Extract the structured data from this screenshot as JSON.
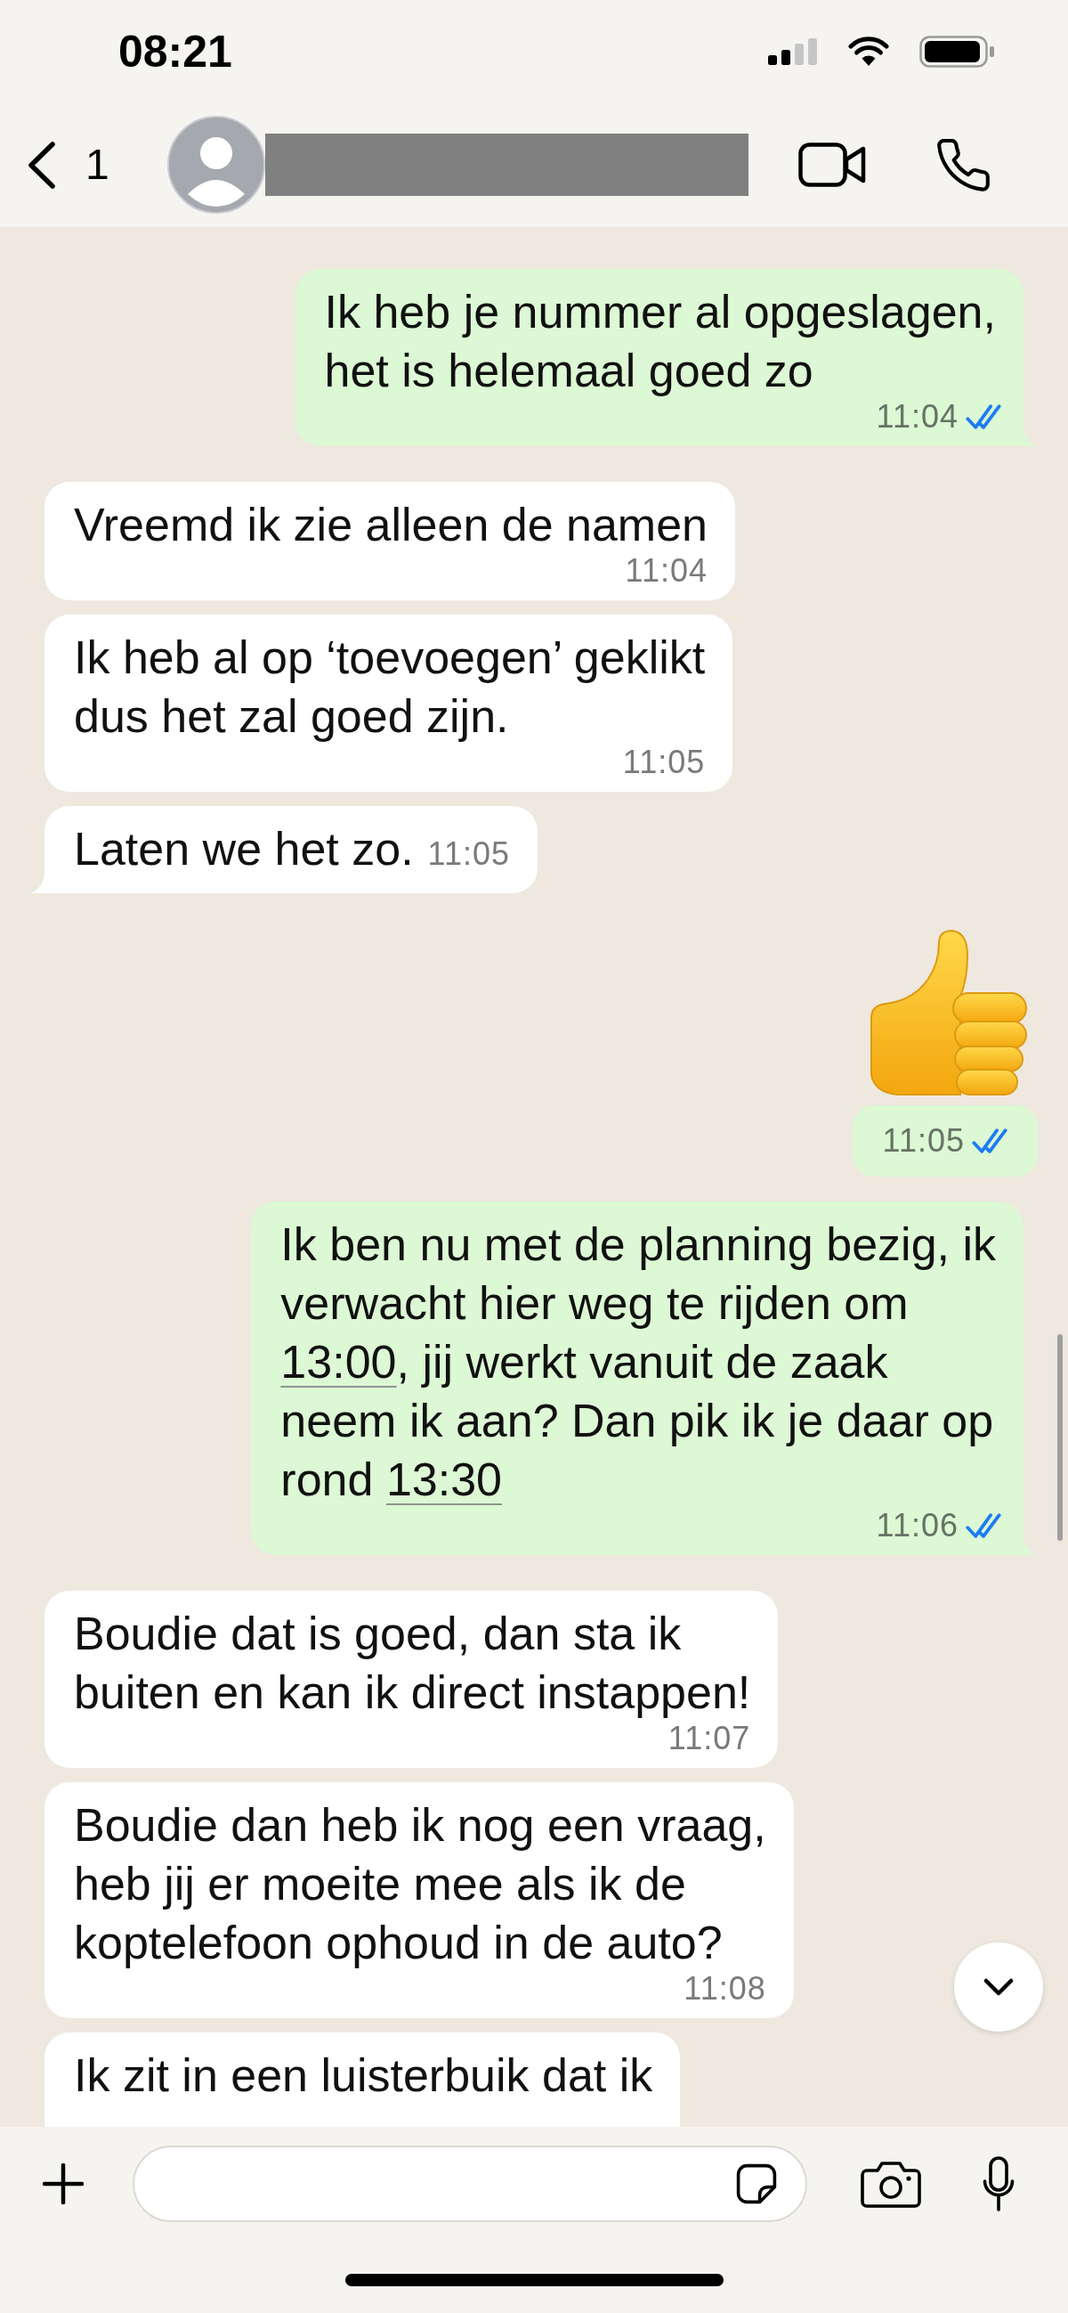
{
  "status_bar": {
    "time": "08:21"
  },
  "header": {
    "back_count": "1"
  },
  "messages": [
    {
      "kind": "text",
      "outgoing": true,
      "text": "Ik heb je nummer al opgeslagen,\nhet is helemaal goed zo",
      "time": "11:04",
      "read": true,
      "tail": true
    },
    {
      "kind": "text",
      "outgoing": false,
      "text": "Vreemd ik zie alleen de namen",
      "time": "11:04",
      "tail": false
    },
    {
      "kind": "text",
      "outgoing": false,
      "text": "Ik heb al op ‘toevoegen’ geklikt\ndus het zal goed zijn.",
      "time": "11:05",
      "tail": false
    },
    {
      "kind": "text",
      "outgoing": false,
      "text": "Laten we het zo.",
      "time": "11:05",
      "tail": true
    },
    {
      "kind": "emoji",
      "outgoing": true,
      "time": "11:05",
      "read": true
    },
    {
      "kind": "text",
      "outgoing": true,
      "segments": [
        {
          "text": "Ik ben nu met de planning bezig, ik\nverwacht hier weg te rijden om\n"
        },
        {
          "text": "13:00",
          "link": true
        },
        {
          "text": ", jij werkt vanuit de zaak\nneem ik aan? Dan pik ik je daar op\nrond "
        },
        {
          "text": "13:30",
          "link": true
        }
      ],
      "time": "11:06",
      "read": true,
      "tail": true
    },
    {
      "kind": "text",
      "outgoing": false,
      "text": "Boudie dat is goed, dan sta ik\nbuiten en kan ik direct instappen!",
      "time": "11:07",
      "tail": false
    },
    {
      "kind": "text",
      "outgoing": false,
      "text": "Boudie dan heb ik nog een vraag,\nheb jij er moeite mee als ik de\nkoptelefoon ophoud in de auto?",
      "time": "11:08",
      "tail": false
    },
    {
      "kind": "text",
      "outgoing": false,
      "text": "Ik zit in een luisterbuik dat ik",
      "tail": false,
      "truncated": true
    }
  ]
}
